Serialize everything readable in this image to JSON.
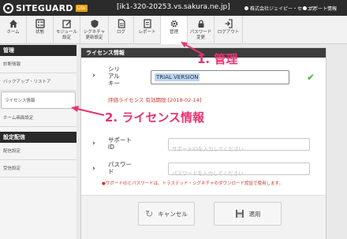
{
  "header": {
    "logo_text": "SITEGUARD",
    "logo_badge": "Lite",
    "host": "[ik1-320-20253.vs.sakura.ne.jp]",
    "company": "株式会社ジェイピー・セキュア",
    "support": "サポート情報"
  },
  "nav": {
    "items": [
      {
        "label": "ホーム",
        "icon": "home-icon"
      },
      {
        "label": "状態",
        "icon": "status-icon"
      },
      {
        "label": "モジュール\n設定",
        "icon": "module-icon"
      },
      {
        "label": "シグネチャ\n更新設定",
        "icon": "signature-icon"
      },
      {
        "label": "ログ",
        "icon": "log-icon"
      },
      {
        "label": "レポート",
        "icon": "report-icon"
      },
      {
        "label": "管理",
        "icon": "gear-icon",
        "active": true
      },
      {
        "label": "パスワード\n変更",
        "icon": "lock-icon"
      },
      {
        "label": "ログアウト",
        "icon": "logout-icon"
      }
    ]
  },
  "sidebar": {
    "section1": "管理",
    "items1": [
      "診断情報",
      "バックアップ・リストア",
      "ライセンス情報",
      "ホーム画面設定"
    ],
    "section2": "設定配信",
    "items2": [
      "配信設定",
      "受信設定"
    ]
  },
  "panel": {
    "title": "ライセンス情報",
    "serial_label": "シリ\nアル\nキー",
    "serial_value": "TRIAL VERSION",
    "eval_text": "評価ライセンス 有効期限:[2018-02-14]",
    "support_label": "サポート\nID",
    "support_placeholder": "サポートIDを入力してください",
    "password_label": "パスワー\nド",
    "password_placeholder": "パスワードを入力してください",
    "note": "●サポートIDとパスワードは、トラステッド・シグネチャのダウンロード認証で使用します。",
    "cancel_label": "キャンセル",
    "apply_label": "適用"
  },
  "annotations": {
    "step1": "1. 管理",
    "step2": "2. ライセンス情報"
  },
  "colors": {
    "accent_pink": "#e8336f",
    "error_red": "#d0342c",
    "check_green": "#4caa36"
  }
}
